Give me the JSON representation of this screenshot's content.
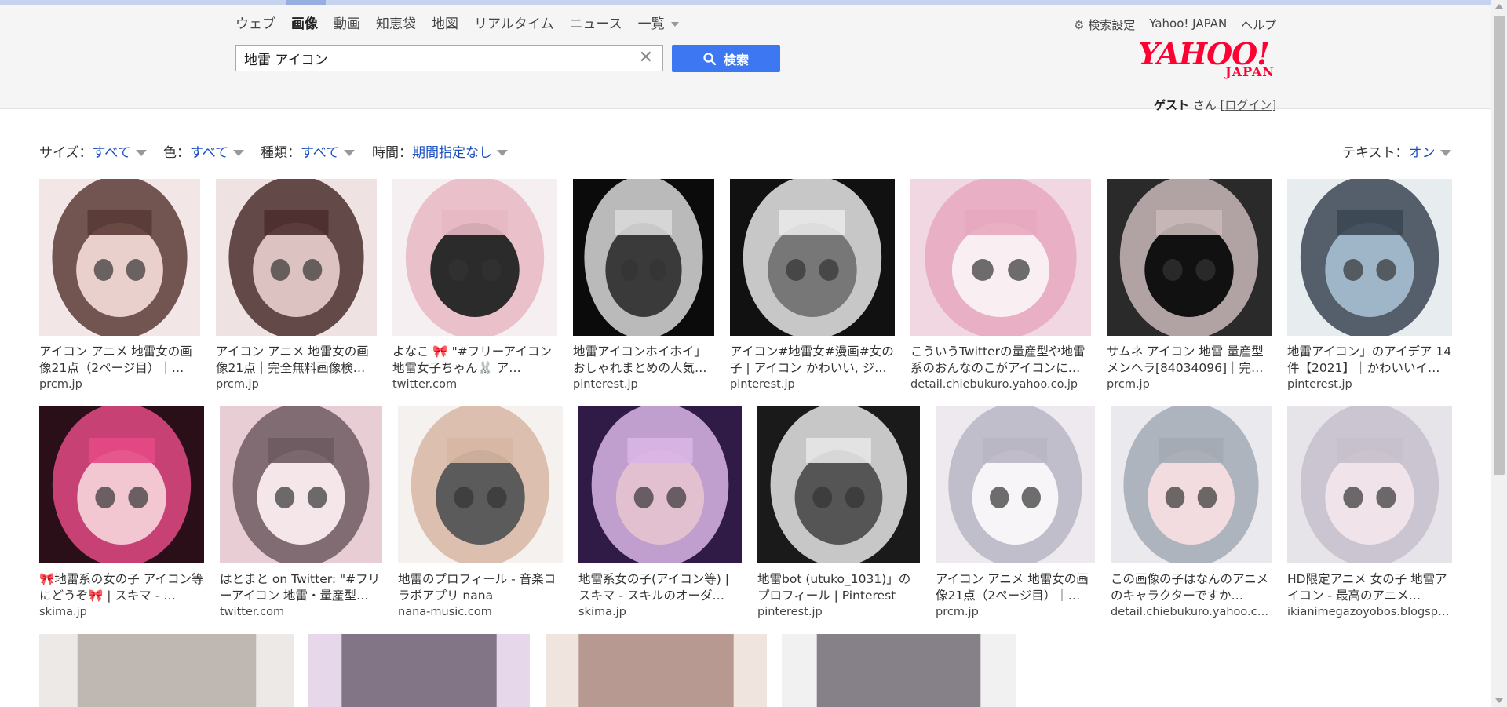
{
  "nav": {
    "tabs": [
      {
        "label": "ウェブ"
      },
      {
        "label": "画像"
      },
      {
        "label": "動画"
      },
      {
        "label": "知恵袋"
      },
      {
        "label": "地図"
      },
      {
        "label": "リアルタイム"
      },
      {
        "label": "ニュース"
      },
      {
        "label": "一覧"
      }
    ]
  },
  "search": {
    "query": "地雷 アイコン",
    "button_label": "検索"
  },
  "util": {
    "settings": "検索設定",
    "yahoo_japan": "Yahoo! JAPAN",
    "help": "ヘルプ"
  },
  "logo": {
    "main": "YAHOO!",
    "sub": "JAPAN"
  },
  "user": {
    "guest": "ゲスト",
    "suffix": " さん [",
    "login": "ログイン",
    "close": "]"
  },
  "filters": {
    "size_label": "サイズ：",
    "size_value": "すべて",
    "color_label": "色：",
    "color_value": "すべて",
    "type_label": "種類：",
    "type_value": "すべて",
    "time_label": "時間：",
    "time_value": "期間指定なし",
    "text_label": "テキスト：",
    "text_value": "オン"
  },
  "colors": {
    "accent": "#3d77f2",
    "brand": "#ff0033",
    "link": "#1a4fbf"
  },
  "results": [
    {
      "title": "アイコン アニメ 地雷女の画像21点（2ページ目）｜…",
      "domain": "prcm.jp"
    },
    {
      "title": "アイコン アニメ 地雷女の画像21点｜完全無料画像検…",
      "domain": "prcm.jp"
    },
    {
      "title": "よなこ 🎀 \"#フリーアイコン 地雷女子ちゃん🐰 ア…",
      "domain": "twitter.com"
    },
    {
      "title": "地雷アイコンホイホイ」おしゃれまとめの人気…",
      "domain": "pinterest.jp"
    },
    {
      "title": "アイコン#地雷女#漫画#女の子 | アイコン かわいい, ジ…",
      "domain": "pinterest.jp"
    },
    {
      "title": "こういうTwitterの量産型や地雷系のおんなのこがアイコンに…",
      "domain": "detail.chiebukuro.yahoo.co.jp"
    },
    {
      "title": "サムネ アイコン 地雷 量産型 メンヘラ[84034096]｜完…",
      "domain": "prcm.jp"
    },
    {
      "title": "地雷アイコン」のアイデア 14 件【2021】｜かわいいイ…",
      "domain": "pinterest.jp"
    },
    {
      "title": "🎀地雷系の女の子 アイコン等にどうぞ🎀 | スキマ - …",
      "domain": "skima.jp"
    },
    {
      "title": "はとまと on Twitter: \"#フリーアイコン 地雷・量産型…",
      "domain": "twitter.com"
    },
    {
      "title": "地雷のプロフィール - 音楽コラボアプリ nana",
      "domain": "nana-music.com"
    },
    {
      "title": "地雷系女の子(アイコン等) | スキマ - スキルのオーダ…",
      "domain": "skima.jp"
    },
    {
      "title": "地雷bot (utuko_1031)」のプロフィール | Pinterest",
      "domain": "pinterest.jp"
    },
    {
      "title": "アイコン アニメ 地雷女の画像21点（2ページ目）｜…",
      "domain": "prcm.jp"
    },
    {
      "title": "この画像の子はなんのアニメのキャラクターですか…",
      "domain": "detail.chiebukuro.yahoo.co.jp"
    },
    {
      "title": "HD限定アニメ 女の子 地雷アイコン - 最高のアニメ…",
      "domain": "ikianimegazoyobos.blogspot.…"
    }
  ]
}
